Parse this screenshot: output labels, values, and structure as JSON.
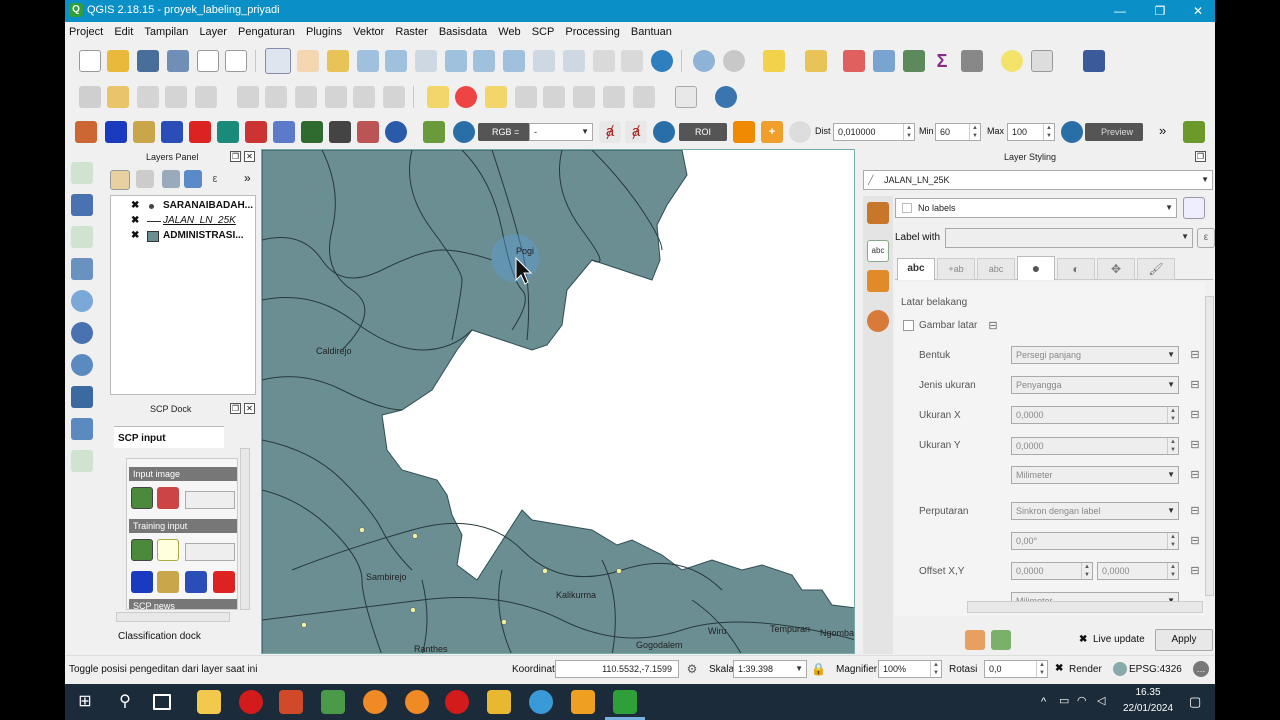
{
  "window": {
    "title": "QGIS 2.18.15 - proyek_labeling_priyadi",
    "minimize": "—",
    "maximize": "❐",
    "close": "✕"
  },
  "menu": [
    "Project",
    "Edit",
    "Tampilan",
    "Layer",
    "Pengaturan",
    "Plugins",
    "Vektor",
    "Raster",
    "Basisdata",
    "Web",
    "SCP",
    "Processing",
    "Bantuan"
  ],
  "scp_toolbar": {
    "rgb_label": "RGB =",
    "rgb_value": "-",
    "roi_label": "ROI",
    "dist_label": "Dist",
    "dist_value": "0,010000",
    "min_label": "Min",
    "min_value": "60",
    "max_label": "Max",
    "max_value": "100",
    "preview_label": "Preview",
    "more": "»"
  },
  "layers_panel": {
    "title": "Layers Panel",
    "more": "»",
    "layers": [
      {
        "name": "SARANAIBADAH...",
        "type": "point",
        "checked": true
      },
      {
        "name": "JALAN_LN_25K",
        "type": "line",
        "checked": true
      },
      {
        "name": "ADMINISTRASI...",
        "type": "polygon",
        "checked": true
      }
    ]
  },
  "scp_dock": {
    "title": "SCP Dock",
    "tab_label": "SCP input",
    "input_image": "Input image",
    "training_input": "Training input",
    "scp_news": "SCP news",
    "classification_dock": "Classification dock"
  },
  "map": {
    "labels": [
      "Pogi",
      "Caldirejo",
      "Sambirejo",
      "Kalikurma",
      "Gogodalem",
      "Wiru",
      "Tempuran",
      "Ngombak",
      "Ranthes"
    ],
    "colors": {
      "polygon": "#6b8e93",
      "outline": "#2f4f55",
      "highlight": "#5b9bd5"
    }
  },
  "layer_styling": {
    "title": "Layer Styling",
    "layer_name": "JALAN_LN_25K",
    "mode": "No labels",
    "label_with": "Label with",
    "tab_text": "abc",
    "section": "Latar belakang",
    "draw_background": "Gambar latar",
    "rows": [
      {
        "label": "Bentuk",
        "value": "Persegi panjang",
        "kind": "dropdown"
      },
      {
        "label": "Jenis ukuran",
        "value": "Penyangga",
        "kind": "dropdown"
      },
      {
        "label": "Ukuran X",
        "value": "0,0000",
        "kind": "spin"
      },
      {
        "label": "Ukuran Y",
        "value": "0,0000",
        "kind": "spin"
      },
      {
        "label": "",
        "value": "Milimeter",
        "kind": "dropdown"
      },
      {
        "label": "Perputaran",
        "value": "Sinkron dengan label",
        "kind": "dropdown"
      },
      {
        "label": "",
        "value": "0,00°",
        "kind": "spin"
      },
      {
        "label": "Offset X,Y",
        "value": "0,0000",
        "value2": "0,0000",
        "kind": "spin2"
      },
      {
        "label": "",
        "value": "Milimeter",
        "kind": "dropdown"
      }
    ],
    "live_update": "Live update",
    "apply": "Apply"
  },
  "status": {
    "message": "Toggle posisi pengeditan dari layer saat ini",
    "koordinat_label": "Koordinat",
    "koordinat_value": "110.5532,-7.1599",
    "skala_label": "Skala",
    "skala_value": "1:39.398",
    "magnifier_label": "Magnifier",
    "magnifier_value": "100%",
    "rotasi_label": "Rotasi",
    "rotasi_value": "0,0",
    "render_label": "Render",
    "crs": "EPSG:4326"
  },
  "taskbar": {
    "time": "16.35",
    "date": "22/01/2024"
  }
}
